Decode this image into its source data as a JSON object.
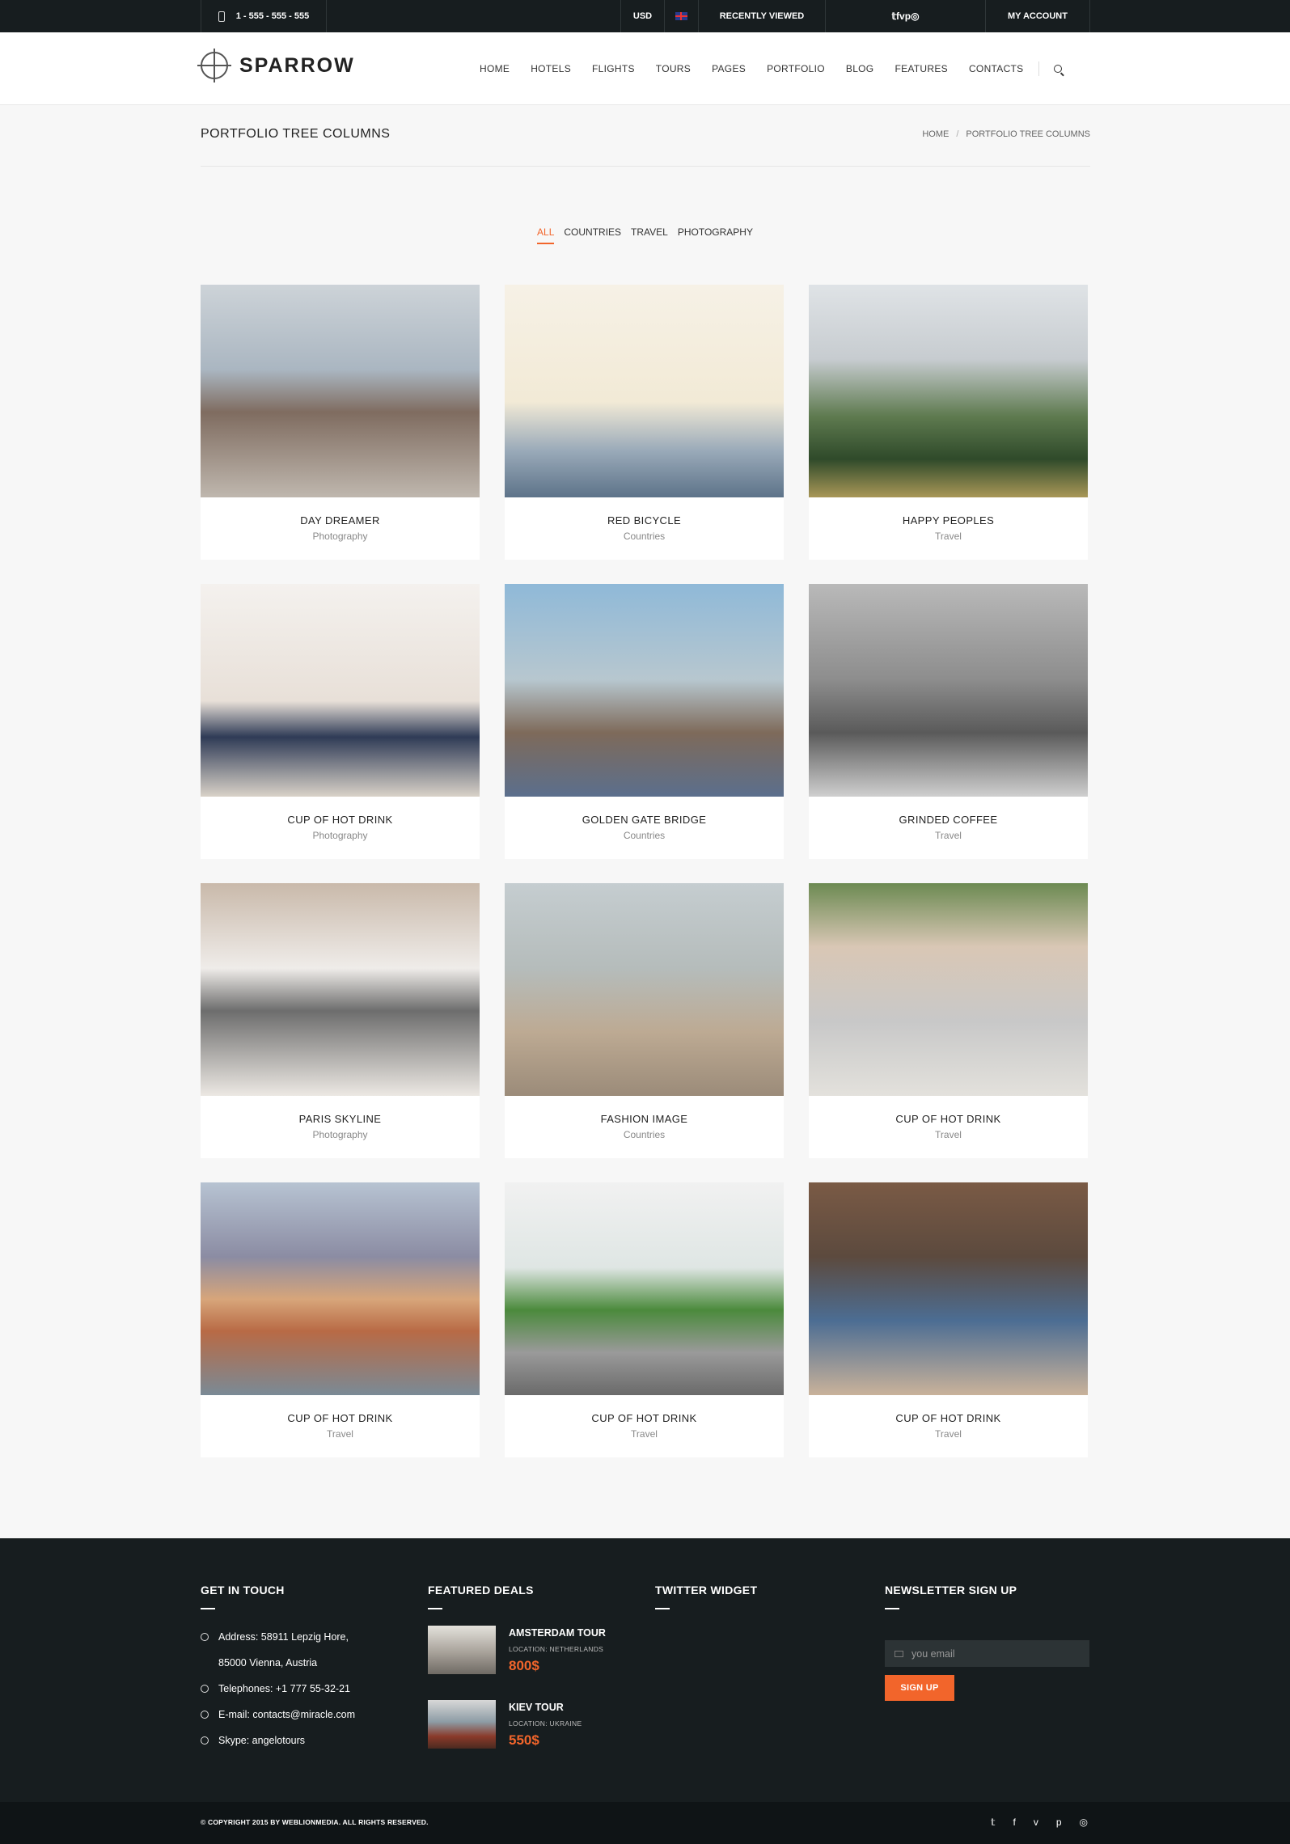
{
  "topbar": {
    "phone": "1 - 555 - 555 - 555",
    "currency": "USD",
    "recently_viewed": "RECENTLY VIEWED",
    "social": [
      "𝕥",
      "f",
      "v",
      "p",
      "◎"
    ],
    "account": "MY ACCOUNT"
  },
  "header": {
    "logo": "SPARROW",
    "nav": [
      "HOME",
      "HOTELS",
      "FLIGHTS",
      "TOURS",
      "PAGES",
      "PORTFOLIO",
      "BLOG",
      "FEATURES",
      "CONTACTS"
    ]
  },
  "page": {
    "title": "PORTFOLIO TREE COLUMNS",
    "breadcrumb": [
      "HOME",
      "/",
      "PORTFOLIO TREE COLUMNS"
    ]
  },
  "filters": [
    "ALL",
    "COUNTRIES",
    "TRAVEL",
    "PHOTOGRAPHY"
  ],
  "portfolio": [
    {
      "title": "DAY DREAMER",
      "category": "Photography"
    },
    {
      "title": "RED BICYCLE",
      "category": "Countries"
    },
    {
      "title": "HAPPY PEOPLES",
      "category": "Travel"
    },
    {
      "title": "CUP OF HOT DRINK",
      "category": "Photography"
    },
    {
      "title": "GOLDEN GATE BRIDGE",
      "category": "Countries"
    },
    {
      "title": "GRINDED COFFEE",
      "category": "Travel"
    },
    {
      "title": "PARIS SKYLINE",
      "category": "Photography"
    },
    {
      "title": "FASHION IMAGE",
      "category": "Countries"
    },
    {
      "title": "CUP OF HOT DRINK",
      "category": "Travel"
    },
    {
      "title": "CUP OF HOT DRINK",
      "category": "Travel"
    },
    {
      "title": "CUP OF HOT DRINK",
      "category": "Travel"
    },
    {
      "title": "CUP OF HOT DRINK",
      "category": "Travel"
    }
  ],
  "footer": {
    "get_in_touch": {
      "heading": "GET IN TOUCH",
      "lines": [
        "Address: 58911 Lepzig Hore,",
        "85000 Vienna, Austria",
        "Telephones: +1 777 55-32-21",
        "E-mail: contacts@miracle.com",
        "Skype: angelotours"
      ]
    },
    "featured_deals": {
      "heading": "FEATURED DEALS",
      "deals": [
        {
          "name": "AMSTERDAM TOUR",
          "location": "LOCATION: NETHERLANDS",
          "price": "800$"
        },
        {
          "name": "KIEV TOUR",
          "location": "LOCATION: UKRAINE",
          "price": "550$"
        }
      ]
    },
    "twitter": {
      "heading": "TWITTER WIDGET"
    },
    "newsletter": {
      "heading": "NEWSLETTER SIGN UP",
      "placeholder": "you email",
      "button": "SIGN UP"
    },
    "copyright": "© COPYRIGHT 2015 BY WEBLIONMEDIA. ALL RIGHTS RESERVED.",
    "social": [
      "𝕥",
      "f",
      "v",
      "p",
      "◎"
    ]
  },
  "colors": {
    "accent": "#f2652b",
    "dark": "#171d1f"
  }
}
